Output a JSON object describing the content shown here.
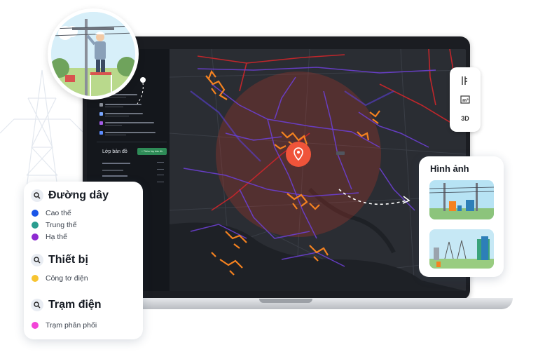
{
  "legend": {
    "sections": [
      {
        "title": "Đường dây",
        "icon": "search-icon",
        "items": [
          {
            "label": "Cao thế",
            "color": "#1a56e8"
          },
          {
            "label": "Trung thế",
            "color": "#2a9d8f"
          },
          {
            "label": "Hạ thế",
            "color": "#8e2bd1"
          }
        ]
      },
      {
        "title": "Thiết bị",
        "icon": "search-icon",
        "items": [
          {
            "label": "Công tơ điện",
            "color": "#f7c431"
          }
        ]
      },
      {
        "title": "Trạm điện",
        "icon": "search-icon",
        "items": [
          {
            "label": "Trạm phân phối",
            "color": "#f245d8"
          }
        ]
      }
    ]
  },
  "images_panel": {
    "title": "Hình ảnh"
  },
  "map_tools": {
    "view3d_label": "3D"
  },
  "app": {
    "layer_title": "Lớp bản đồ",
    "add_layer_label": "+ Thêm lớp bản đồ"
  },
  "colors": {
    "accent_orange": "#f58220",
    "pin_red": "#f0543a",
    "line_purple": "#6b3fd1",
    "line_red": "#c0262b"
  }
}
